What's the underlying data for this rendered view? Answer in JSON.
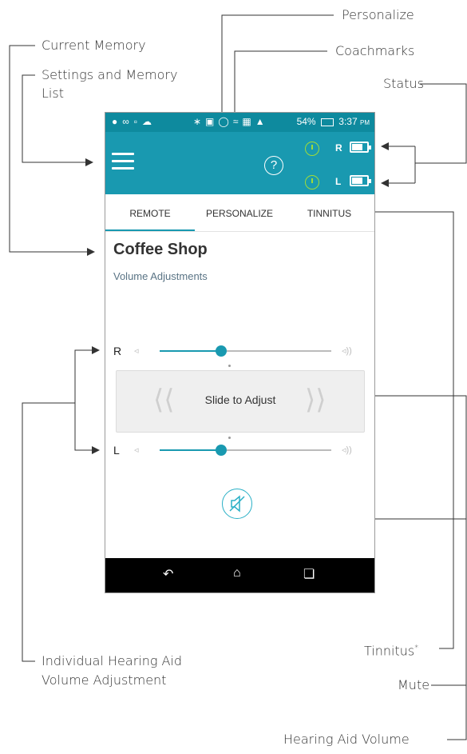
{
  "callouts": {
    "personalize": "Personalize",
    "current_memory": "Current Memory",
    "coachmarks": "Coachmarks",
    "settings_line1": "Settings and Memory",
    "settings_line2": "List",
    "status": "Status",
    "tinnitus": "Tinnitus",
    "tinnitus_mark": "*",
    "mute": "Mute",
    "individual_line1": "Individual Hearing Aid",
    "individual_line2": "Volume Adjustment",
    "hearing_aid_volume": "Hearing Aid Volume"
  },
  "phone": {
    "status_bar": {
      "battery_pct": "54%",
      "time": "3:37",
      "time_suffix": "PM"
    },
    "header": {
      "help_glyph": "?",
      "right_label": "R",
      "left_label": "L",
      "right_battery_level": 0.7,
      "left_battery_level": 0.7
    },
    "tabs": [
      "REMOTE",
      "PERSONALIZE",
      "TINNITUS"
    ],
    "active_tab": "REMOTE",
    "memory_name": "Coffee Shop",
    "subtitle": "Volume Adjustments",
    "volume": {
      "right_label": "R",
      "left_label": "L",
      "right_level": 0.36,
      "left_level": 0.36
    },
    "slide_label": "Slide to Adjust"
  },
  "colors": {
    "accent": "#1999b0",
    "status_bar": "#0e8a9e",
    "battery_ring": "#9fdc38"
  }
}
